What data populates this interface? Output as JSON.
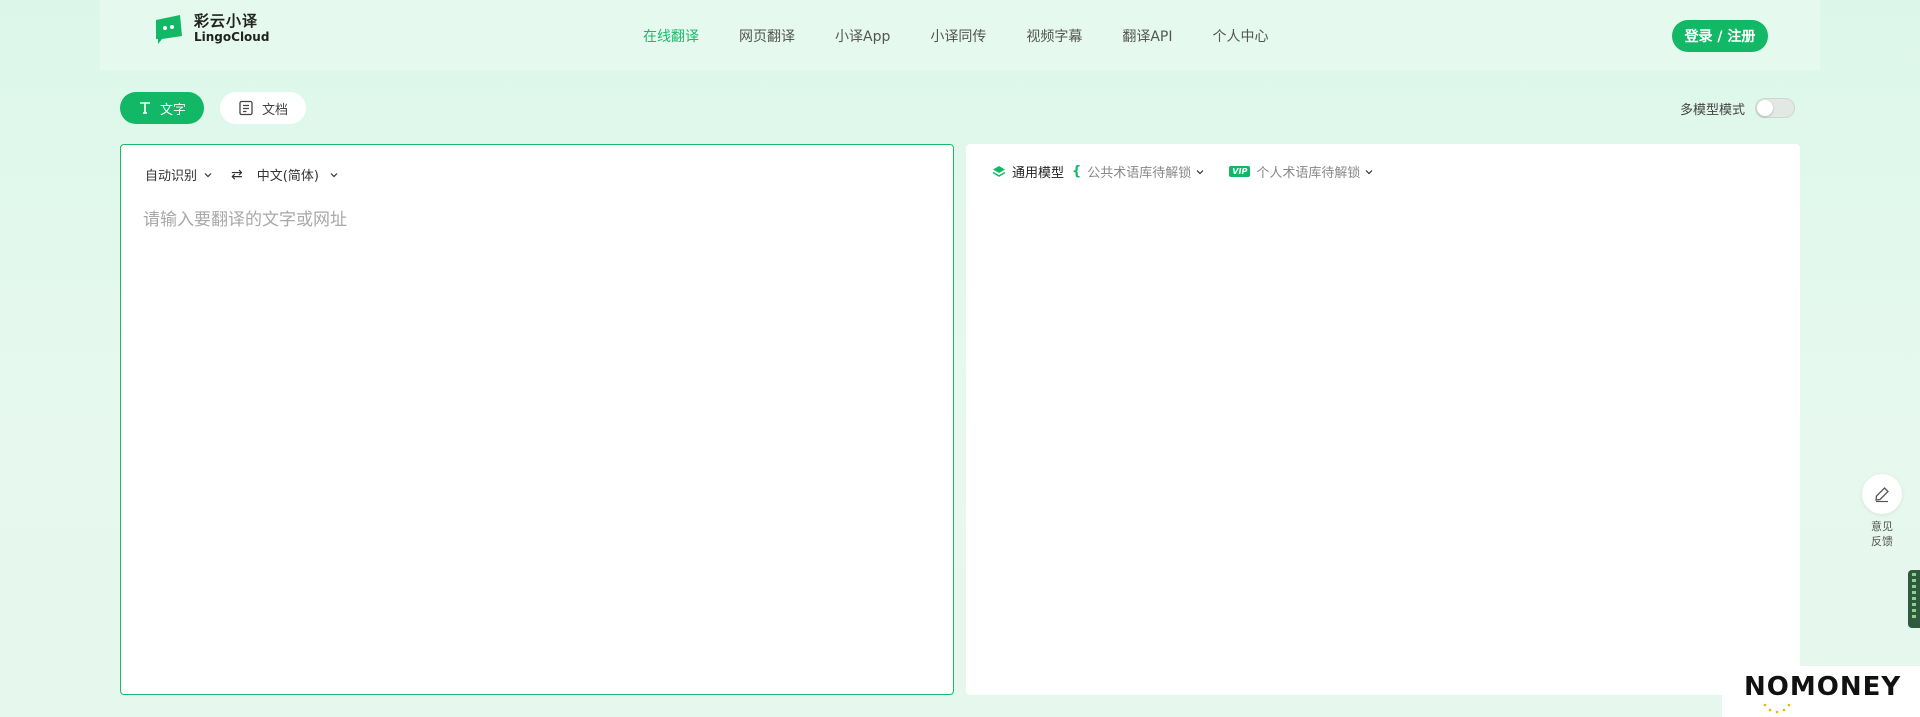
{
  "header": {
    "logo_cn": "彩云小译",
    "logo_en": "LingoCloud",
    "nav": [
      {
        "label": "在线翻译",
        "active": true
      },
      {
        "label": "网页翻译",
        "active": false
      },
      {
        "label": "小译App",
        "active": false
      },
      {
        "label": "小译同传",
        "active": false
      },
      {
        "label": "视频字幕",
        "active": false
      },
      {
        "label": "翻译API",
        "active": false
      },
      {
        "label": "个人中心",
        "active": false
      }
    ],
    "login_label": "登录 / 注册"
  },
  "mode_tabs": {
    "text_label": "文字",
    "doc_label": "文档"
  },
  "multi_model": {
    "label": "多模型模式",
    "enabled": false
  },
  "source": {
    "source_lang": "自动识别",
    "swap_icon": "swap-icon",
    "target_lang": "中文(简体)",
    "placeholder": "请输入要翻译的文字或网址",
    "value": ""
  },
  "target": {
    "model_label": "通用模型",
    "public_terms": "公共术语库待解锁",
    "vip_badge": "VIP",
    "personal_terms": "个人术语库待解锁"
  },
  "feedback": {
    "line1": "意见",
    "line2": "反馈"
  },
  "watermark": {
    "text": "NOMONEY"
  },
  "colors": {
    "accent": "#12b866",
    "background": "#e3f8ec",
    "panel": "#ffffff"
  }
}
